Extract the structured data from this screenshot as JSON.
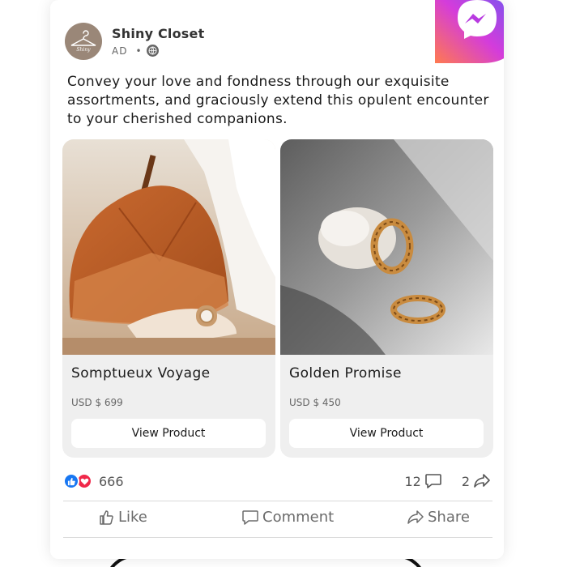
{
  "post": {
    "page_name": "Shiny Closet",
    "ad_label": "AD",
    "dot": "•",
    "avatar_text": "Shiny",
    "caption": "Convey your love and fondness through our exquisite assortments, and graciously extend this opulent encounter to your cherished companions."
  },
  "products": [
    {
      "title": "Somptueux Voyage",
      "price": "USD $ 699",
      "button": "View Product"
    },
    {
      "title": "Golden Promise",
      "price": "USD $ 450",
      "button": "View Product"
    }
  ],
  "stats": {
    "reactions": "666",
    "comments": "12",
    "shares": "2"
  },
  "actions": {
    "like": "Like",
    "comment": "Comment",
    "share": "Share"
  },
  "colors": {
    "like_blue": "#1877f2",
    "love_red": "#f0284a",
    "messenger_gradient": [
      "#ff5d8f",
      "#a33cf0",
      "#5b5cf6"
    ]
  },
  "icons": [
    "messenger-icon",
    "hanger-icon",
    "globe-icon",
    "like-reaction-icon",
    "love-reaction-icon",
    "comment-icon",
    "share-icon",
    "thumbs-up-icon"
  ]
}
